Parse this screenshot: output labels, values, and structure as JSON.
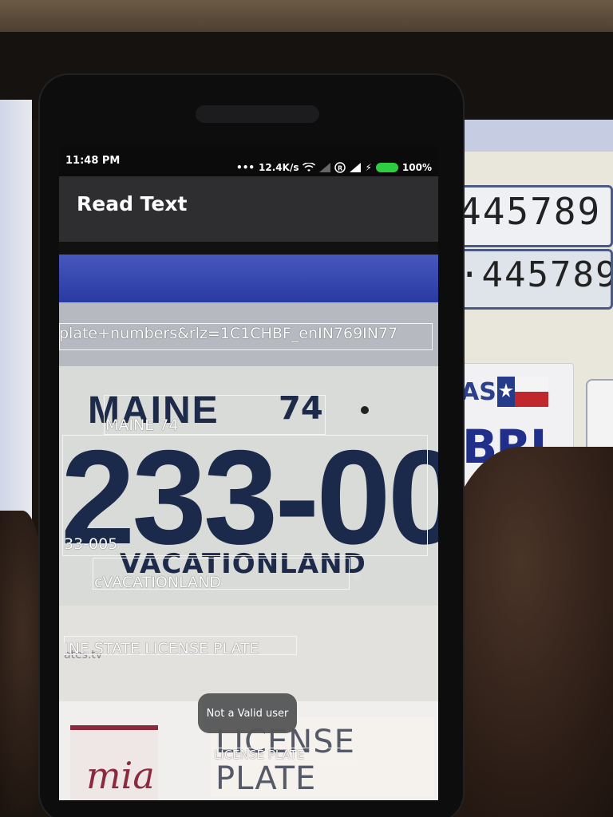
{
  "status_bar": {
    "time": "11:48 PM",
    "network_speed": "12.4K/s",
    "battery": "100%",
    "icons": [
      "wifi-icon",
      "signal-icon",
      "registered-icon",
      "signal-icon",
      "charging-icon",
      "battery-icon"
    ]
  },
  "app_bar": {
    "title": "Read Text"
  },
  "plate": {
    "state": "MAINE",
    "year": "74",
    "number": "233-005",
    "slogan": "VACATIONLAND"
  },
  "ocr_results": [
    "plate+numbers&rlz=1C1CHBF_enIN769IN77",
    "MAINE 74",
    "33-005",
    "cVACATIONLAND",
    "INE STATE LICENSE PLATE",
    "LICENSE PLATE"
  ],
  "background_plates": {
    "right_1": "445789",
    "right_2": "·445789",
    "texas_top": "AS",
    "texas_main": "BRI",
    "mia_text": "mia",
    "license_plate_text": "LICENSE PLATE",
    "faded_text": "ates.tv"
  },
  "toast": {
    "message": "Not a Valid user"
  }
}
